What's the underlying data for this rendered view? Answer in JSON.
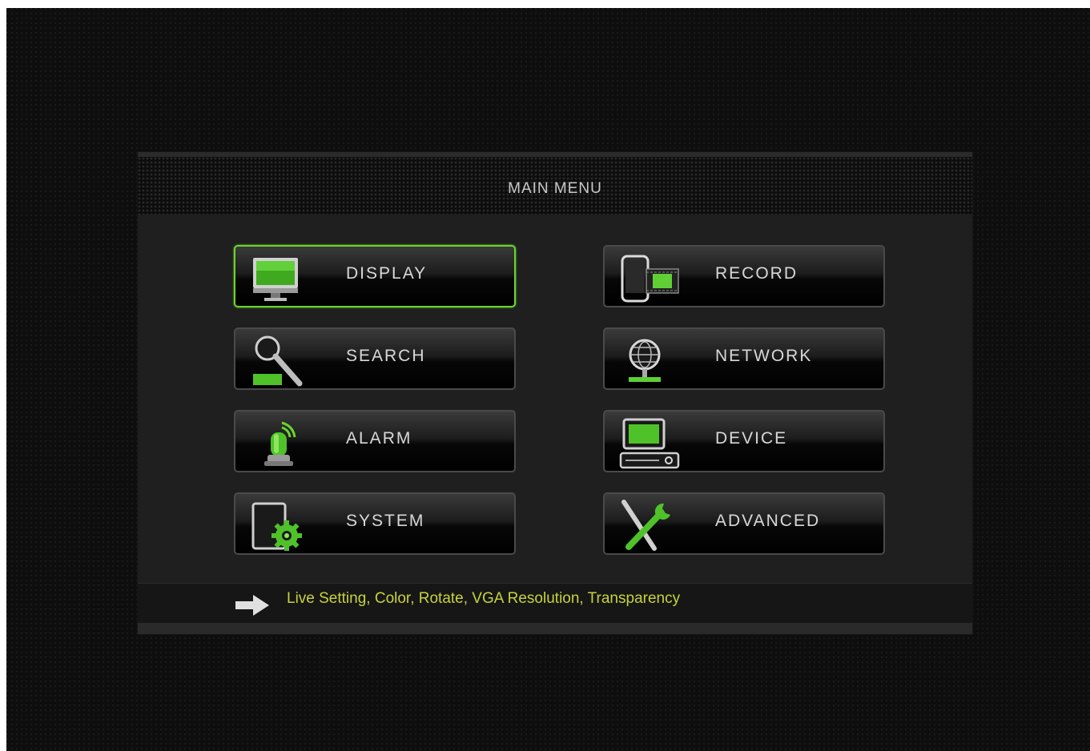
{
  "main_menu": {
    "title": "MAIN MENU",
    "buttons": [
      {
        "label": "DISPLAY",
        "icon": "monitor-icon",
        "selected": true
      },
      {
        "label": "RECORD",
        "icon": "record-device-icon",
        "selected": false
      },
      {
        "label": "SEARCH",
        "icon": "magnifier-icon",
        "selected": false
      },
      {
        "label": "NETWORK",
        "icon": "globe-network-icon",
        "selected": false
      },
      {
        "label": "ALARM",
        "icon": "alarm-beacon-icon",
        "selected": false
      },
      {
        "label": "DEVICE",
        "icon": "dvr-device-icon",
        "selected": false
      },
      {
        "label": "SYSTEM",
        "icon": "system-gear-icon",
        "selected": false
      },
      {
        "label": "ADVANCED",
        "icon": "tools-icon",
        "selected": false
      }
    ]
  },
  "status_bar": {
    "text": "Live Setting, Color, Rotate, VGA Resolution, Transparency",
    "icon": "arrow-right-icon"
  },
  "colors": {
    "accent": "#6cd32e",
    "status_text": "#c8d33a",
    "label": "#d8d8d8"
  }
}
